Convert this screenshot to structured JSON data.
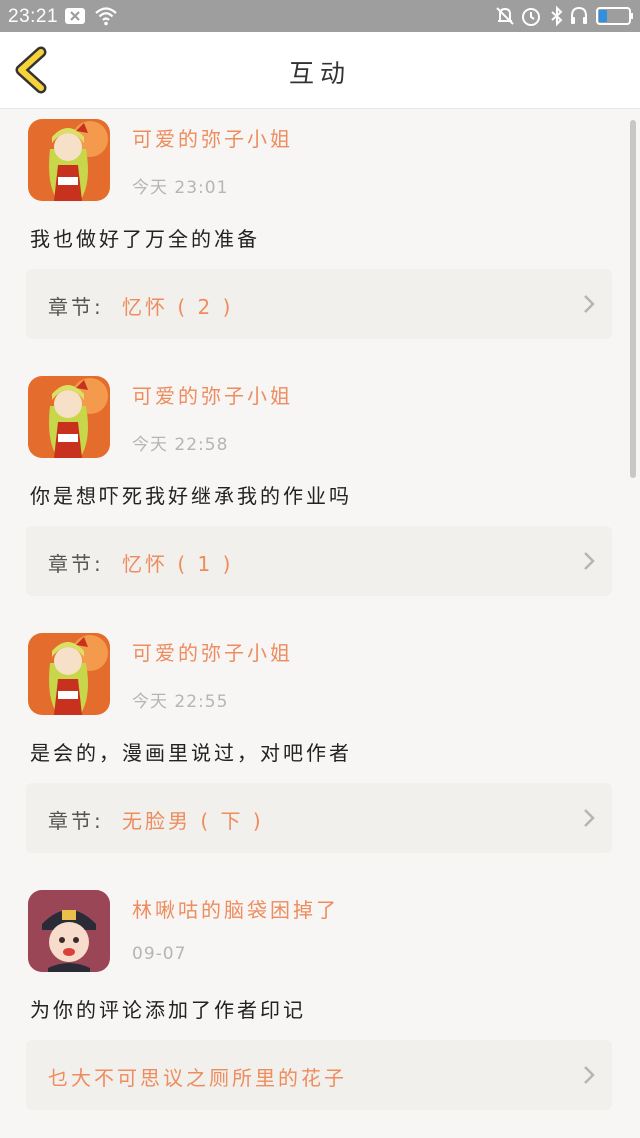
{
  "status_bar": {
    "time": "23:21",
    "left_icons": [
      "close-notification-icon",
      "wifi-icon"
    ],
    "right_icons": [
      "mute-icon",
      "alarm-icon",
      "bluetooth-icon",
      "headset-icon",
      "battery-icon"
    ]
  },
  "header": {
    "title": "互动",
    "back_icon": "chevron-left-icon"
  },
  "accent_color": "#ee8c5e",
  "items": [
    {
      "avatar": "girl-avatar",
      "username": "可爱的弥子小姐",
      "time": "今天 23:01",
      "comment": "我也做好了万全的准备",
      "chapter_prefix": "章节:",
      "chapter": "忆怀 ( 2 )"
    },
    {
      "avatar": "girl-avatar",
      "username": "可爱的弥子小姐",
      "time": "今天 22:58",
      "comment": "你是想吓死我好继承我的作业吗",
      "chapter_prefix": "章节:",
      "chapter": "忆怀 ( 1 )"
    },
    {
      "avatar": "girl-avatar",
      "username": "可爱的弥子小姐",
      "time": "今天 22:55",
      "comment": "是会的，漫画里说过，对吧作者",
      "chapter_prefix": "章节:",
      "chapter": "无脸男 ( 下 )"
    },
    {
      "avatar": "boy-avatar",
      "username": "林啾咕的脑袋困掉了",
      "time": "09-07",
      "comment": "为你的评论添加了作者印记",
      "chapter": "乜大不可思议之厕所里的花子"
    }
  ]
}
